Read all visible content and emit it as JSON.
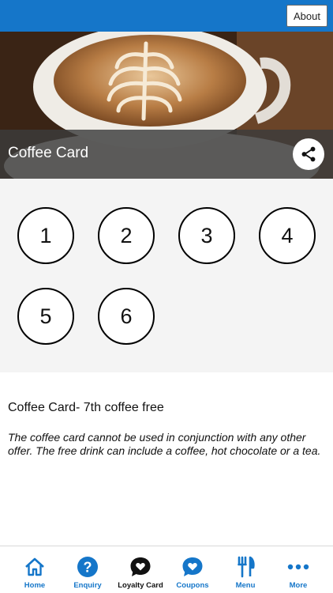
{
  "header": {
    "about_label": "About",
    "accent_color": "#1576c9"
  },
  "hero": {
    "title": "Coffee Card",
    "image_subject": "latte-art-coffee-cup",
    "share_icon": "share-icon"
  },
  "stamps": [
    "1",
    "2",
    "3",
    "4",
    "5",
    "6"
  ],
  "offer": {
    "title": "Coffee Card- 7th coffee free",
    "description": "The coffee card cannot be used in conjunction with any other offer. The free drink can include a coffee, hot chocolate or a tea."
  },
  "tabs": [
    {
      "label": "Home",
      "icon": "home-icon",
      "active": false
    },
    {
      "label": "Enquiry",
      "icon": "question-icon",
      "active": false
    },
    {
      "label": "Loyalty Card",
      "icon": "heart-chat-icon",
      "active": true
    },
    {
      "label": "Coupons",
      "icon": "coupon-heart-icon",
      "active": false
    },
    {
      "label": "Menu",
      "icon": "fork-knife-icon",
      "active": false
    },
    {
      "label": "More",
      "icon": "more-dots-icon",
      "active": false
    }
  ]
}
